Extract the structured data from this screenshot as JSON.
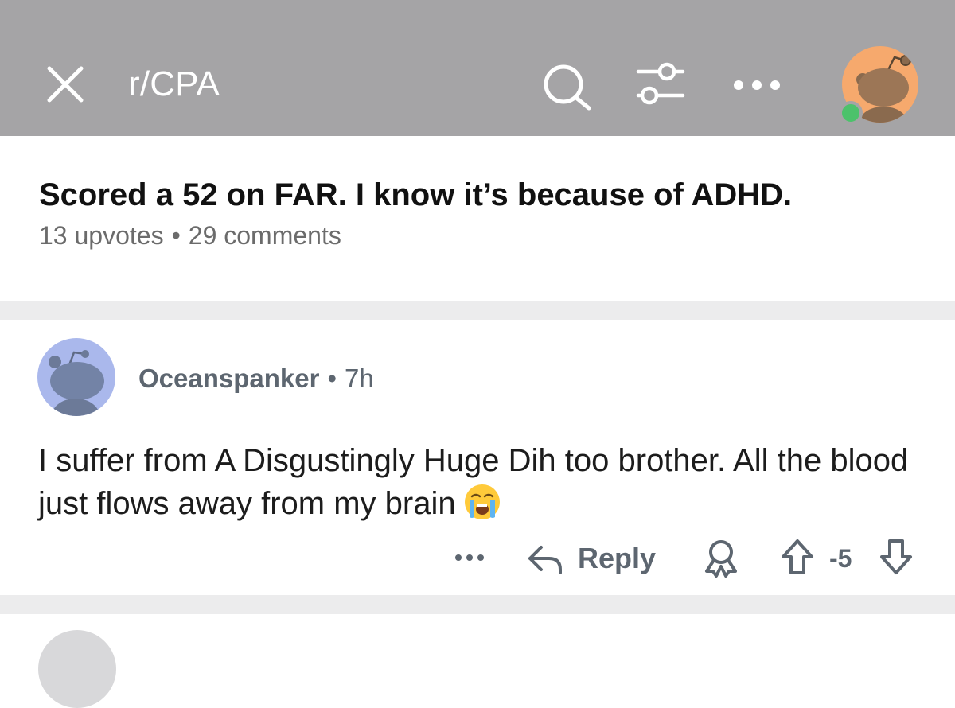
{
  "header": {
    "title": "r/CPA",
    "close_icon": "close-icon",
    "search_icon": "search-icon",
    "filter_icon": "filter-sliders-icon",
    "more_icon": "more-horizontal-icon",
    "avatar_icon": "snoo-avatar",
    "background": "#a5a4a6",
    "online_color": "#4cc26b"
  },
  "post": {
    "title": "Scored a 52 on FAR. I know it’s because of ADHD.",
    "upvotes": "13 upvotes",
    "separator": "•",
    "comments": "29 comments"
  },
  "comment": {
    "username": "Oceanspanker",
    "separator": "•",
    "time": "7h",
    "body": "I suffer from A Disgustingly Huge Dih too brother. All the blood just flows away from my brain",
    "emoji": "loudly-crying-face-emoji",
    "actions": {
      "more_icon": "more-horizontal-icon",
      "reply_label": "Reply",
      "award_icon": "award-icon",
      "upvote_icon": "upvote-arrow-icon",
      "score": "-5",
      "downvote_icon": "downvote-arrow-icon"
    }
  }
}
